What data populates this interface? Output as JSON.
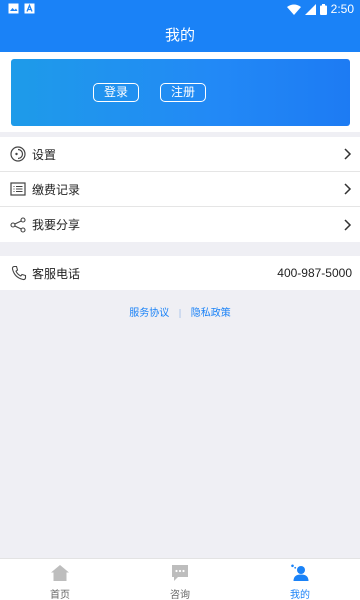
{
  "status_bar": {
    "time": "2:50"
  },
  "header": {
    "title": "我的"
  },
  "account_card": {
    "login_label": "登录",
    "register_label": "注册"
  },
  "menu": [
    {
      "label": "设置",
      "icon": "settings-icon"
    },
    {
      "label": "缴费记录",
      "icon": "payment-record-icon"
    },
    {
      "label": "我要分享",
      "icon": "share-icon"
    }
  ],
  "service": {
    "label": "客服电话",
    "phone": "400-987-5000"
  },
  "links": {
    "service_agreement": "服务协议",
    "separator": "|",
    "privacy_policy": "隐私政策"
  },
  "tabs": [
    {
      "label": "首页",
      "icon": "home-icon",
      "active": false
    },
    {
      "label": "咨询",
      "icon": "chat-icon",
      "active": false
    },
    {
      "label": "我的",
      "icon": "user-icon",
      "active": true
    }
  ],
  "colors": {
    "primary": "#1a82f7",
    "background": "#efeff4"
  }
}
